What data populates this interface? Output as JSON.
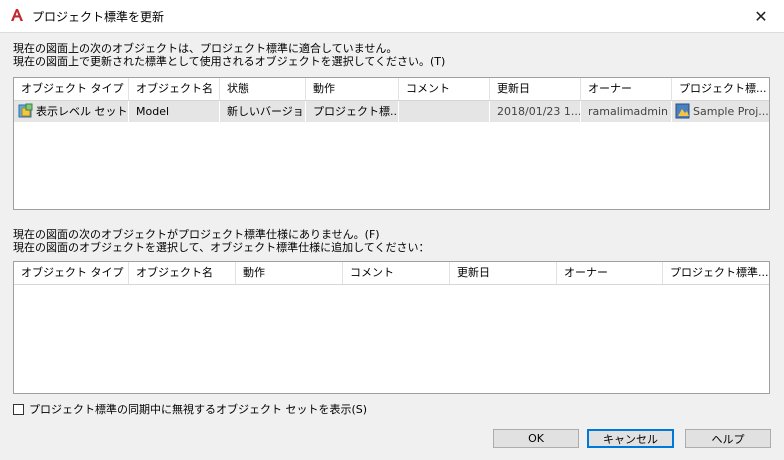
{
  "window": {
    "title": "プロジェクト標準を更新",
    "close_glyph": "✕"
  },
  "top_section": {
    "desc_line1": "現在の図面上の次のオブジェクトは、プロジェクト標準に適合していません。",
    "desc_line2": "現在の図面上で更新された標準として使用されるオブジェクトを選択してください。(T)",
    "columns": [
      "オブジェクト タイプ",
      "オブジェクト名",
      "状態",
      "動作",
      "コメント",
      "更新日",
      "オーナー",
      "プロジェクト標..."
    ],
    "rows": [
      {
        "object_type": "表示レベル セット",
        "object_name": "Model",
        "status": "新しいバージョン",
        "action": "プロジェクト標...",
        "comment": "",
        "updated": "2018/01/23 1...",
        "owner": "ramalimadmin",
        "project_standard": "Sample Proj..."
      }
    ]
  },
  "bottom_section": {
    "desc_line1": "現在の図面の次のオブジェクトがプロジェクト標準仕様にありません。(F)",
    "desc_line2": "現在の図面のオブジェクトを選択して、オブジェクト標準仕様に追加してください：",
    "columns": [
      "オブジェクト タイプ",
      "オブジェクト名",
      "動作",
      "コメント",
      "更新日",
      "オーナー",
      "プロジェクト標準..."
    ],
    "rows": []
  },
  "checkbox": {
    "label": "プロジェクト標準の同期中に無視するオブジェクト セットを表示(S)",
    "checked": false
  },
  "buttons": {
    "ok": "OK",
    "cancel": "キャンセル",
    "help": "ヘルプ"
  },
  "colors": {
    "accent": "#0078d7",
    "app_icon_red": "#c1272d",
    "selected_row": "#e5e5e5"
  }
}
